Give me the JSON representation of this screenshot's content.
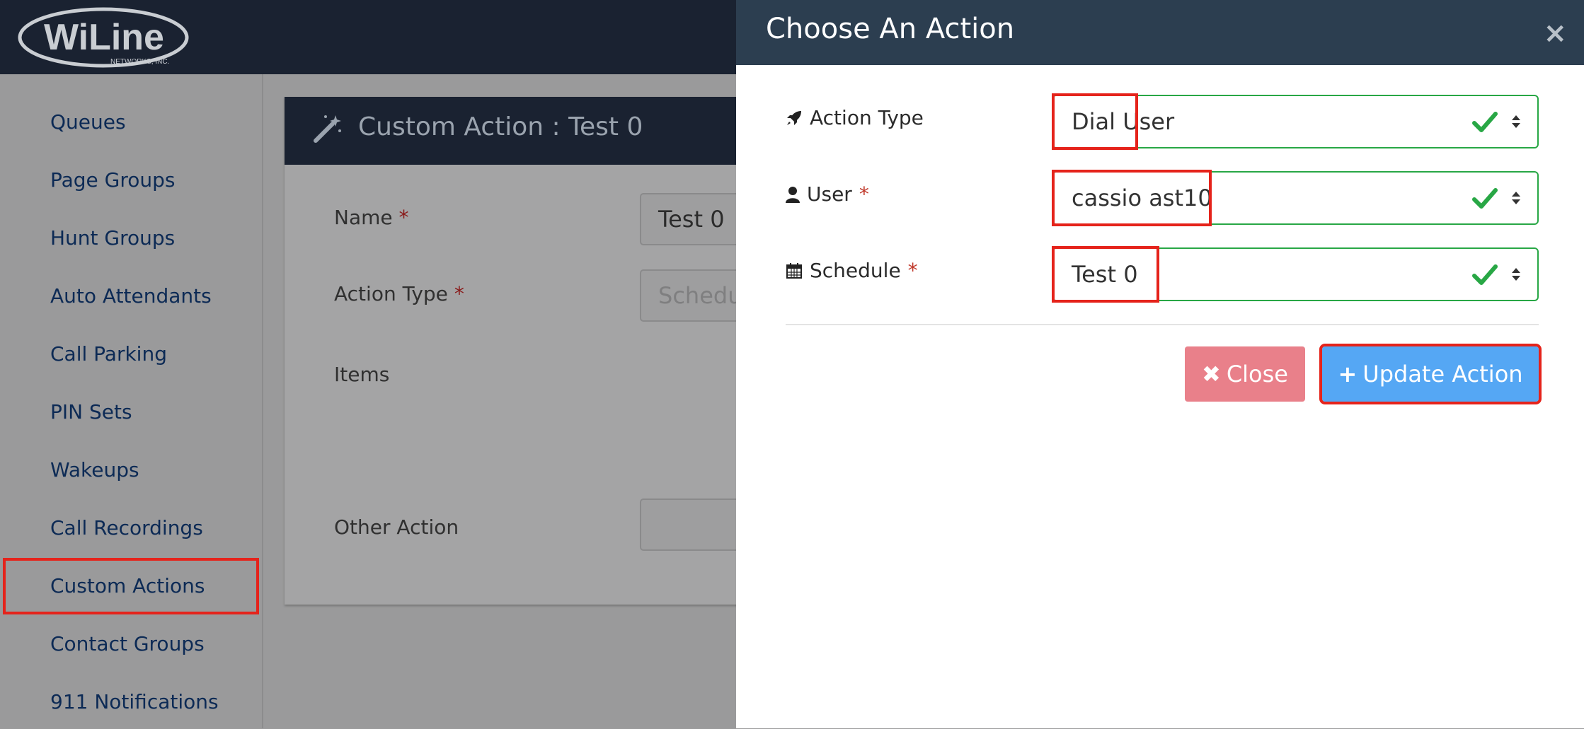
{
  "brand": {
    "logo_text": "WiLine",
    "logo_subtext": "NETWORKS, INC."
  },
  "sidebar": {
    "items": [
      {
        "label": "Queues"
      },
      {
        "label": "Page Groups"
      },
      {
        "label": "Hunt Groups"
      },
      {
        "label": "Auto Attendants"
      },
      {
        "label": "Call Parking"
      },
      {
        "label": "PIN Sets"
      },
      {
        "label": "Wakeups"
      },
      {
        "label": "Call Recordings"
      },
      {
        "label": "Custom Actions",
        "active": true
      },
      {
        "label": "Contact Groups"
      },
      {
        "label": "911 Notifications"
      }
    ]
  },
  "card": {
    "title": "Custom Action : Test 0",
    "icon": "magic-wand-icon",
    "fields": {
      "name": {
        "label": "Name",
        "required": "*",
        "value": "Test 0"
      },
      "action_type": {
        "label": "Action Type",
        "required": "*",
        "placeholder": "Schedu"
      },
      "items": {
        "label": "Items"
      },
      "other_action": {
        "label": "Other Action"
      }
    }
  },
  "modal": {
    "title": "Choose An Action",
    "close_symbol": "×",
    "rows": {
      "action_type": {
        "icon": "rocket-icon",
        "label": "Action Type",
        "value": "Dial User"
      },
      "user": {
        "icon": "user-icon",
        "label": "User",
        "required": "*",
        "value": "cassio ast10"
      },
      "schedule": {
        "icon": "calendar-icon",
        "label": "Schedule",
        "required": "*",
        "value": "Test 0"
      }
    },
    "buttons": {
      "close": {
        "icon": "✖",
        "label": "Close"
      },
      "update": {
        "icon": "+",
        "label": "Update Action"
      }
    }
  },
  "colors": {
    "accent_valid": "#28a745",
    "highlight": "#e5231b",
    "primary_button": "#55a7f4",
    "danger_button": "#e9808a",
    "header_dark": "#2c3e50"
  }
}
